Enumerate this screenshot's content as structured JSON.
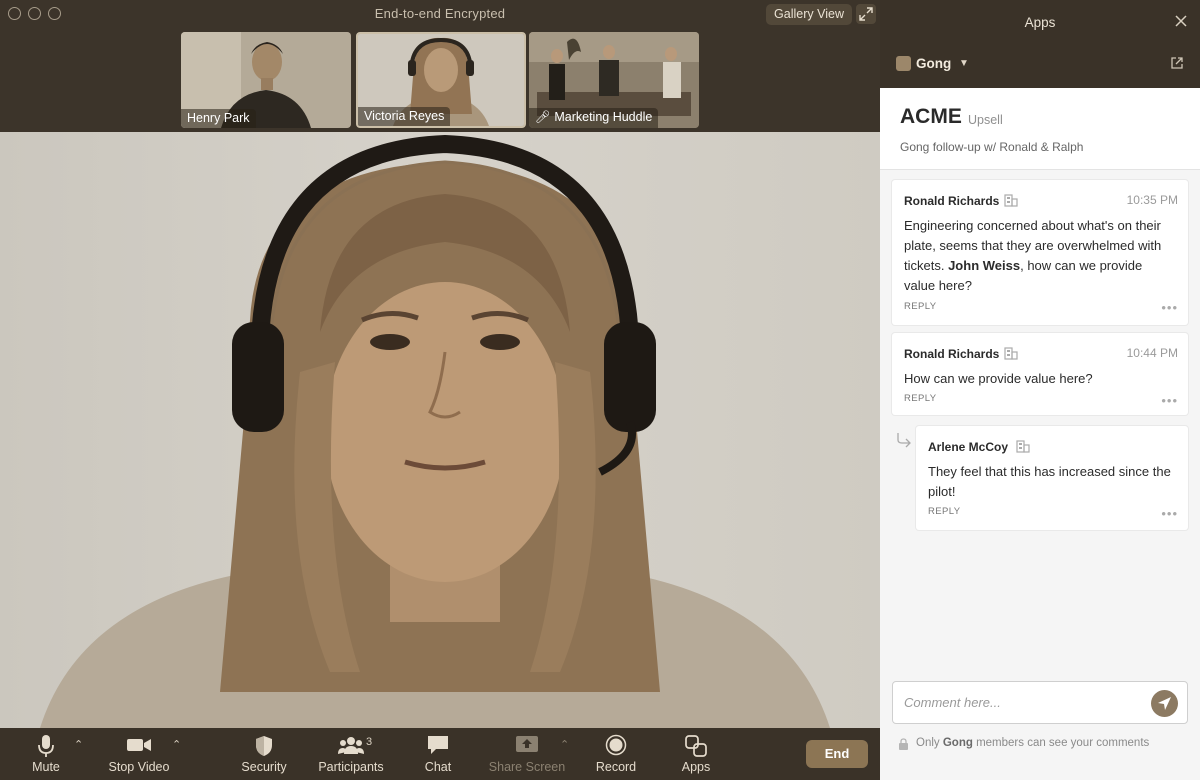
{
  "window": {
    "title": "End-to-end Encrypted",
    "gallery_view_label": "Gallery View"
  },
  "thumbnails": [
    {
      "label": "Henry Park"
    },
    {
      "label": "Victoria Reyes"
    },
    {
      "label": "Marketing Huddle"
    }
  ],
  "toolbar": {
    "mute": "Mute",
    "stop_video": "Stop Video",
    "security": "Security",
    "participants": "Participants",
    "participants_count": "3",
    "chat": "Chat",
    "share_screen": "Share Screen",
    "record": "Record",
    "apps": "Apps",
    "end": "End"
  },
  "apps_panel": {
    "title": "Apps",
    "app_name": "Gong",
    "deal": {
      "name": "ACME",
      "stage": "Upsell",
      "subtitle": "Gong follow-up w/ Ronald & Ralph"
    },
    "comments": [
      {
        "author": "Ronald Richards",
        "time": "10:35 PM",
        "text_before": "Engineering concerned about what's on their plate, seems that they are overwhelmed with tickets. ",
        "mention": "John Weiss",
        "text_after": ", how can we provide value here?",
        "reply_label": "REPLY"
      },
      {
        "author": "Ronald Richards",
        "time": "10:44 PM",
        "text": "How can we provide value here?",
        "reply_label": "REPLY"
      },
      {
        "author": "Arlene McCoy",
        "text": "They feel that this has increased since the pilot!",
        "reply_label": "REPLY"
      }
    ],
    "comment_placeholder": "Comment here...",
    "privacy_prefix": "Only ",
    "privacy_app": "Gong",
    "privacy_suffix": " members can see your comments"
  }
}
